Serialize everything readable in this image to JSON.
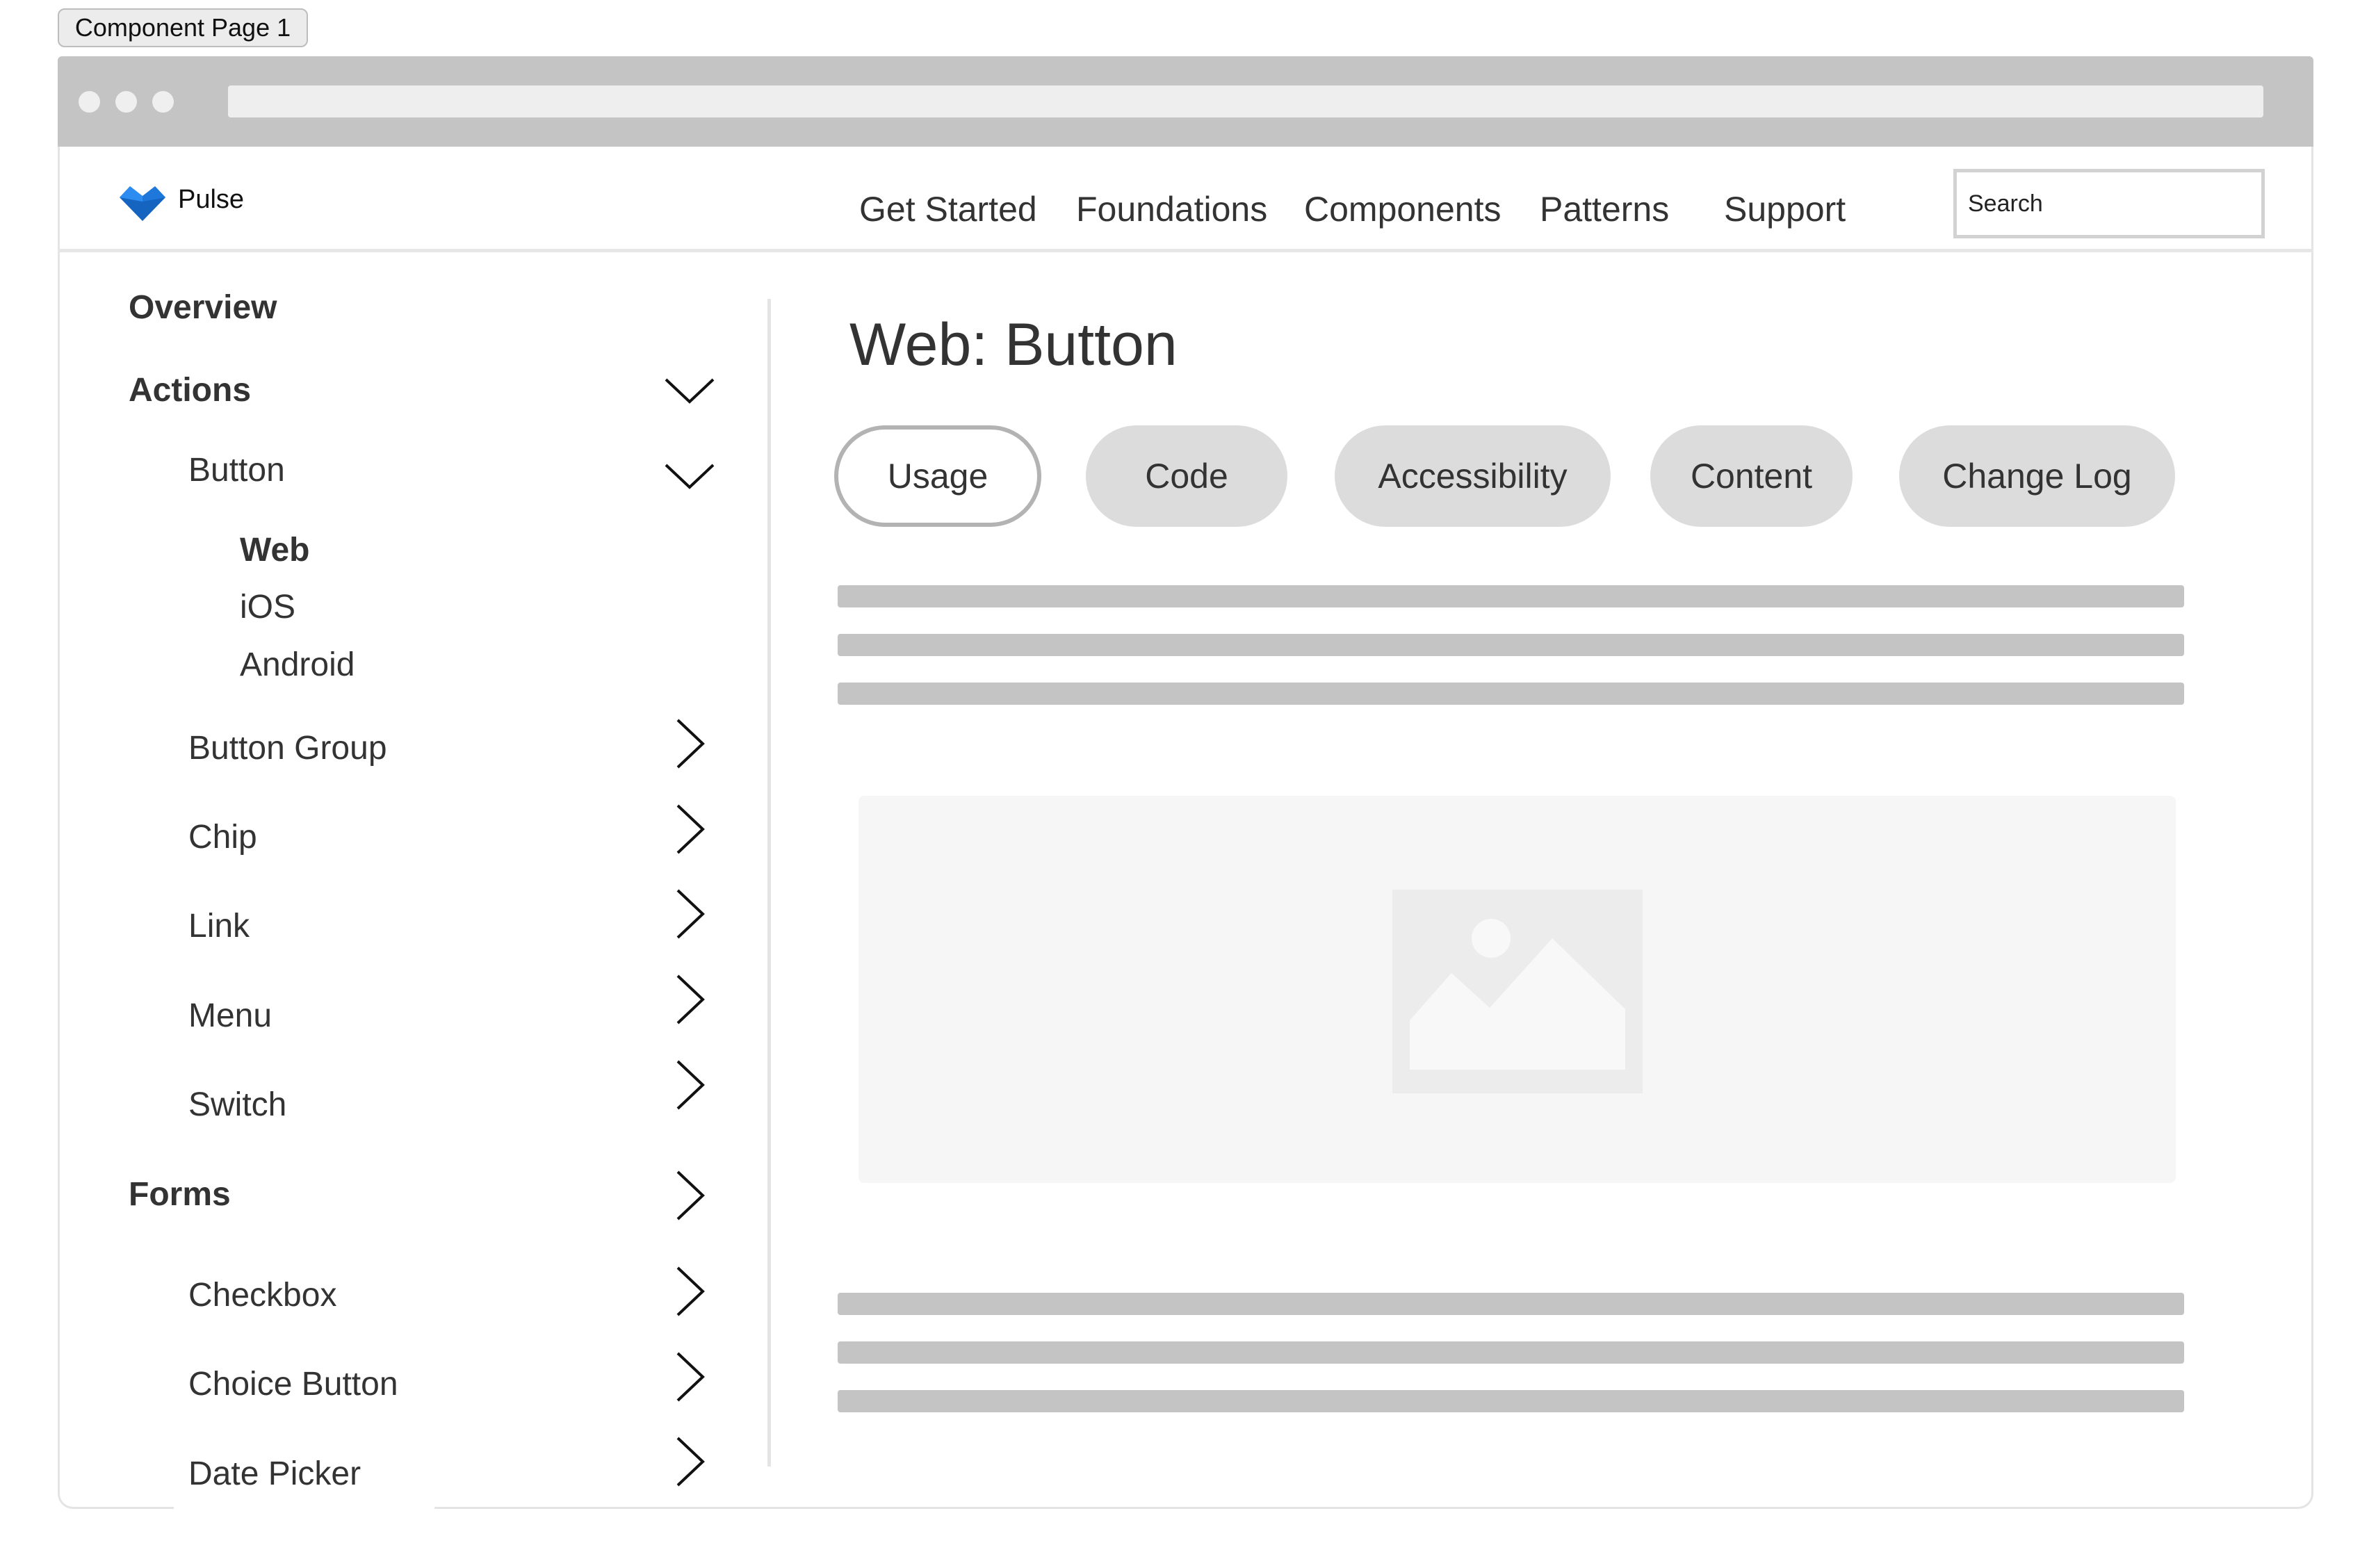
{
  "frame": {
    "label": "Component Page 1"
  },
  "header": {
    "brand": "Pulse",
    "nav": [
      "Get Started",
      "Foundations",
      "Components",
      "Patterns",
      "Support"
    ],
    "search": {
      "placeholder": "Search",
      "value": ""
    }
  },
  "sidebar": {
    "items": [
      {
        "label": "Overview",
        "level": 0
      },
      {
        "label": "Actions",
        "level": 0,
        "state": "expanded"
      },
      {
        "label": "Button",
        "level": 1,
        "state": "expanded"
      },
      {
        "label": "Web",
        "level": 2,
        "active": true
      },
      {
        "label": "iOS",
        "level": 2
      },
      {
        "label": "Android",
        "level": 2
      },
      {
        "label": "Button Group",
        "level": 1,
        "state": "collapsed"
      },
      {
        "label": "Chip",
        "level": 1,
        "state": "collapsed"
      },
      {
        "label": "Link",
        "level": 1,
        "state": "collapsed"
      },
      {
        "label": "Menu",
        "level": 1,
        "state": "collapsed"
      },
      {
        "label": "Switch",
        "level": 1,
        "state": "collapsed"
      },
      {
        "label": "Forms",
        "level": 0,
        "state": "collapsed"
      },
      {
        "label": "Checkbox",
        "level": 1,
        "state": "collapsed"
      },
      {
        "label": "Choice Button",
        "level": 1,
        "state": "collapsed"
      },
      {
        "label": "Date Picker",
        "level": 1,
        "state": "collapsed"
      }
    ]
  },
  "main": {
    "title": "Web: Button",
    "tabs": [
      {
        "label": "Usage",
        "active": true
      },
      {
        "label": "Code"
      },
      {
        "label": "Accessibility"
      },
      {
        "label": "Content"
      },
      {
        "label": "Change Log"
      }
    ]
  },
  "icons": {
    "logo": "heart-logo-icon",
    "expanded": "chevron-down-icon",
    "collapsed": "chevron-right-icon",
    "image": "image-placeholder-icon"
  },
  "colors": {
    "brand_blue": "#1565c0",
    "brand_blue_light": "#2d8cf0",
    "chrome_gray": "#c4c4c4",
    "tab_inactive": "#dcdcdc",
    "tab_active_border": "#b3b3b3"
  }
}
